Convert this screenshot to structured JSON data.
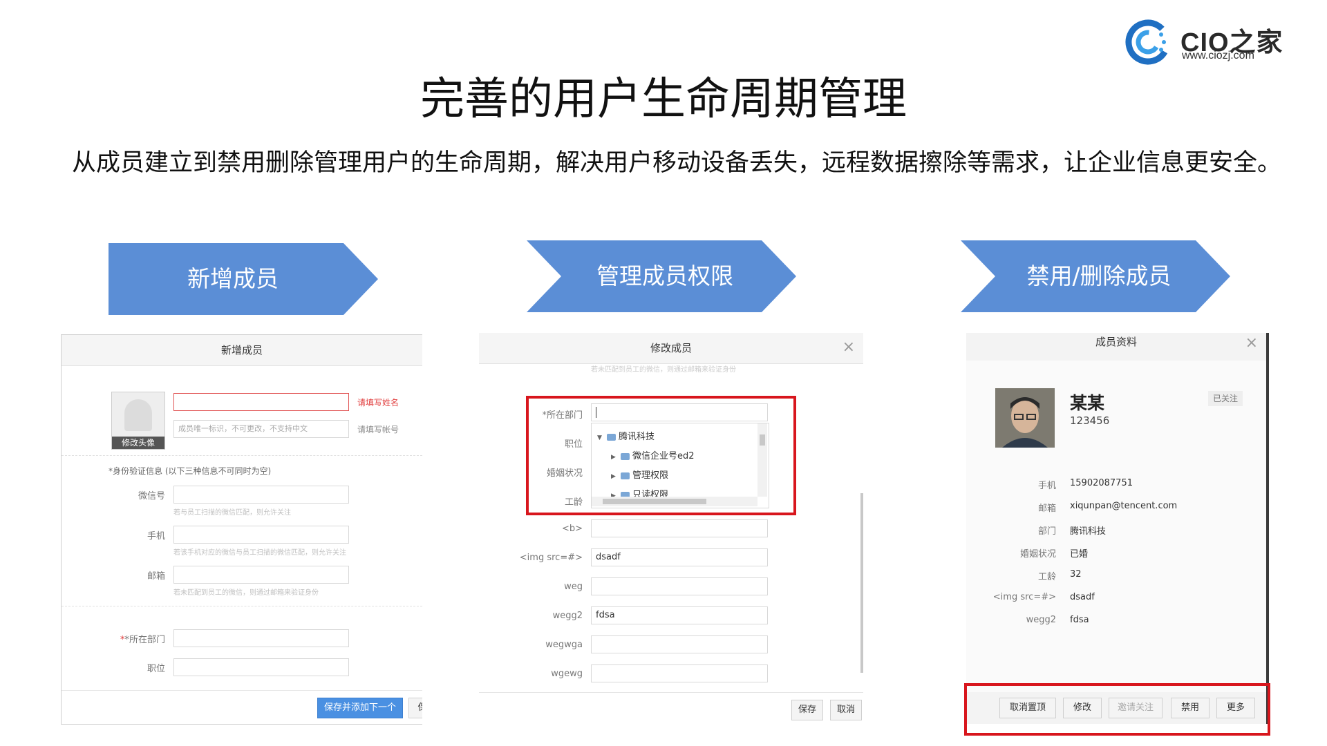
{
  "logo": {
    "name": "CIO之家",
    "url": "www.ciozj.com"
  },
  "title": "完善的用户生命周期管理",
  "description": "从成员建立到禁用删除管理用户的生命周期，解决用户移动设备丢失，远程数据擦除等需求，让企业信息更安全。",
  "steps": [
    "新增成员",
    "管理成员权限",
    "禁用/删除成员"
  ],
  "colors": {
    "arrow": "#5b8ed6",
    "highlight": "#d8161d",
    "primary_button": "#4a90e2"
  },
  "panel1": {
    "header": "新增成员",
    "avatar_label": "修改头像",
    "name_error": "请填写姓名",
    "account_placeholder": "成员唯一标识，不可更改，不支持中文",
    "account_error": "请填写帐号",
    "identity_label": "*身份验证信息",
    "identity_note": "(以下三种信息不可同时为空)",
    "wechat_label": "微信号",
    "wechat_hint": "若与员工扫描的微信匹配，则允许关注",
    "phone_label": "手机",
    "phone_hint": "若该手机对应的微信与员工扫描的微信匹配，则允许关注",
    "email_label": "邮箱",
    "email_hint": "若未匹配到员工的微信，则通过邮箱来验证身份",
    "dept_label": "*所在部门",
    "position_label": "职位",
    "save_next_button": "保存并添加下一个",
    "partial_button": "保"
  },
  "panel2": {
    "header": "修改成员",
    "top_hint": "若未匹配到员工的微信，则通过邮箱来验证身份",
    "fields": [
      {
        "label": "*所在部门",
        "value": ""
      },
      {
        "label": "职位",
        "value": ""
      },
      {
        "label": "婚姻状况",
        "value": ""
      },
      {
        "label": "工龄",
        "value": ""
      },
      {
        "label": "<b>",
        "value": ""
      },
      {
        "label": "<img src=#>",
        "value": "dsadf"
      },
      {
        "label": "weg",
        "value": ""
      },
      {
        "label": "wegg2",
        "value": "fdsa"
      },
      {
        "label": "wegwga",
        "value": ""
      },
      {
        "label": "wgewg",
        "value": ""
      }
    ],
    "tree": [
      "腾讯科技",
      "微信企业号ed2",
      "管理权限",
      "只读权限"
    ],
    "save_button": "保存",
    "cancel_button": "取消"
  },
  "panel3": {
    "header": "成员资料",
    "name": "某某",
    "account": "123456",
    "follow_status": "已关注",
    "details": [
      {
        "label": "手机",
        "value": "15902087751"
      },
      {
        "label": "邮箱",
        "value": "xiqunpan@tencent.com"
      },
      {
        "label": "部门",
        "value": "腾讯科技"
      },
      {
        "label": "婚姻状况",
        "value": "已婚"
      },
      {
        "label": "工龄",
        "value": "32"
      },
      {
        "label": "<img src=#>",
        "value": "dsadf"
      },
      {
        "label": "wegg2",
        "value": "fdsa"
      }
    ],
    "buttons": [
      "取消置顶",
      "修改",
      "邀请关注",
      "禁用",
      "更多"
    ]
  }
}
